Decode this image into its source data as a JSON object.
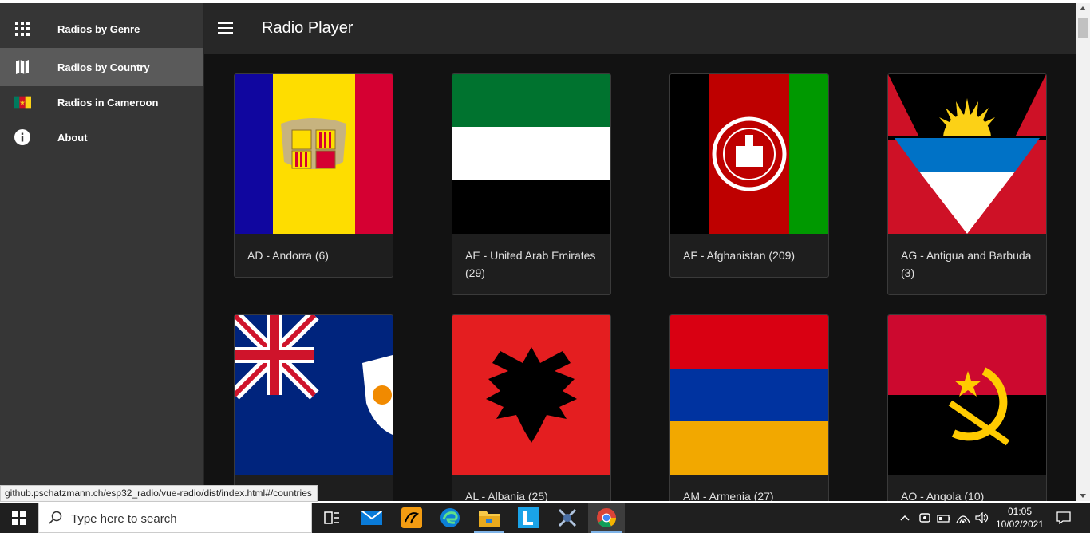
{
  "sidebar": {
    "items": [
      {
        "label": "Radios by Genre",
        "icon": "grid-icon"
      },
      {
        "label": "Radios by Country",
        "icon": "map-icon",
        "active": true
      },
      {
        "label": "Radios in Cameroon",
        "icon": "cameroon-flag-icon"
      },
      {
        "label": "About",
        "icon": "info-icon"
      }
    ]
  },
  "header": {
    "title": "Radio Player",
    "menu_icon": "hamburger-menu-icon"
  },
  "countries": [
    {
      "label": "AD - Andorra (6)",
      "flag": "andorra-flag"
    },
    {
      "label": "AE - United Arab Emirates (29)",
      "flag": "uae-flag"
    },
    {
      "label": "AF - Afghanistan (209)",
      "flag": "afghanistan-flag"
    },
    {
      "label": "AG - Antigua and Barbuda (3)",
      "flag": "antigua-flag"
    },
    {
      "label": ")",
      "flag": "anguilla-flag"
    },
    {
      "label": "AL - Albania (25)",
      "flag": "albania-flag"
    },
    {
      "label": "AM - Armenia (27)",
      "flag": "armenia-flag"
    },
    {
      "label": "AO - Angola (10)",
      "flag": "angola-flag"
    }
  ],
  "status_url": "github.pschatzmann.ch/esp32_radio/vue-radio/dist/index.html#/countries",
  "taskbar": {
    "search_placeholder": "Type here to search",
    "time": "01:05",
    "date": "10/02/2021"
  },
  "colors": {
    "sidebar_bg": "#363636",
    "sidebar_active": "#5a5a5a",
    "topbar_bg": "#272727",
    "content_bg": "#121212",
    "card_bg": "#1e1e1e"
  }
}
